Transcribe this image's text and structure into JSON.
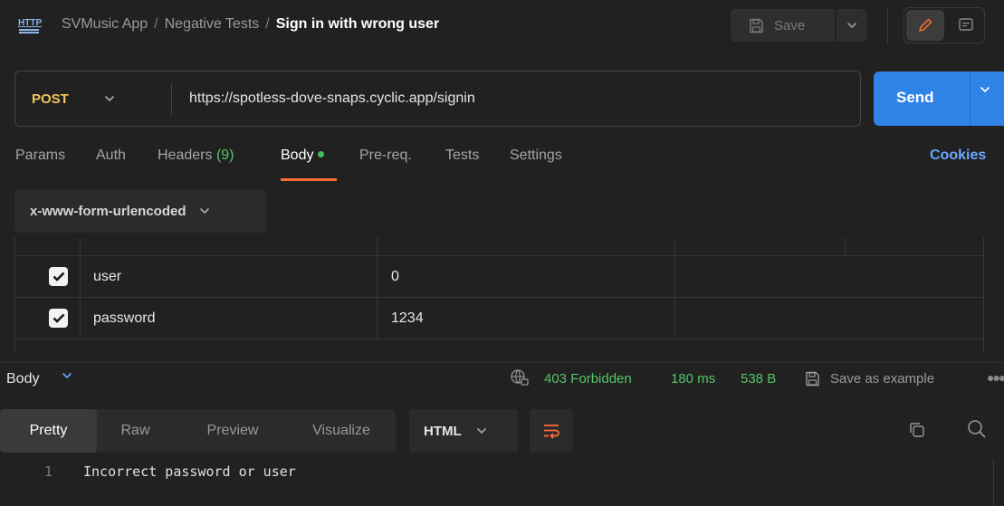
{
  "breadcrumb": {
    "collection": "SVMusic App",
    "folder": "Negative Tests",
    "request": "Sign in with wrong user"
  },
  "toolbar": {
    "save_label": "Save"
  },
  "request": {
    "method": "POST",
    "url": "https://spotless-dove-snaps.cyclic.app/signin",
    "send_label": "Send"
  },
  "tabs": {
    "params": "Params",
    "auth": "Auth",
    "headers": "Headers",
    "headers_count": "(9)",
    "body": "Body",
    "prereq": "Pre-req.",
    "tests": "Tests",
    "settings": "Settings",
    "cookies": "Cookies"
  },
  "body_type": "x-www-form-urlencoded",
  "form_rows": [
    {
      "key": "user",
      "value": "0",
      "checked": true
    },
    {
      "key": "password",
      "value": "1234",
      "checked": true
    }
  ],
  "response": {
    "body_label": "Body",
    "status": "403 Forbidden",
    "time": "180 ms",
    "size": "538 B",
    "save_example": "Save as example"
  },
  "view_tabs": [
    "Pretty",
    "Raw",
    "Preview",
    "Visualize"
  ],
  "format": "HTML",
  "code": {
    "line_number": "1",
    "text": "Incorrect password or user"
  },
  "colors": {
    "accent": "#ff6c37",
    "send": "#2f82e6",
    "status_ok": "#55c46a",
    "method": "#f4c55a",
    "link": "#69a8ff"
  }
}
